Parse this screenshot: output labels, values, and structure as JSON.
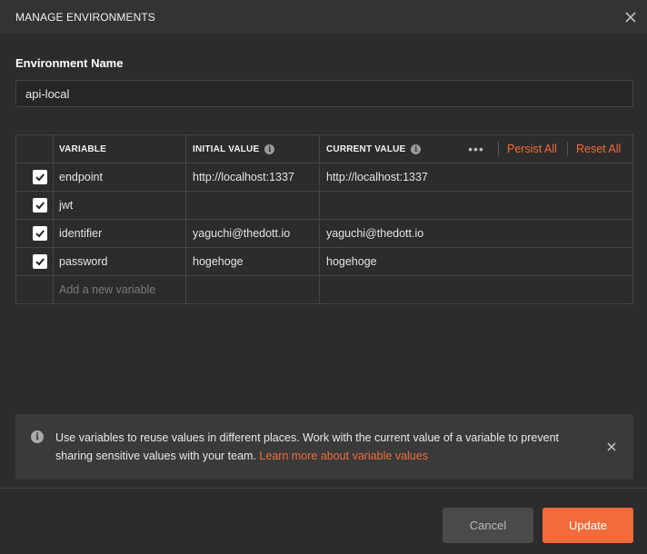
{
  "dialog": {
    "title": "MANAGE ENVIRONMENTS"
  },
  "environment": {
    "label": "Environment Name",
    "value": "api-local"
  },
  "table": {
    "headers": {
      "variable": "VARIABLE",
      "initial_value": "INITIAL VALUE",
      "current_value": "CURRENT VALUE"
    },
    "actions": {
      "more": "•••",
      "persist_all": "Persist All",
      "reset_all": "Reset All"
    },
    "rows": [
      {
        "checked": true,
        "variable": "endpoint",
        "initial": "http://localhost:1337",
        "current": "http://localhost:1337"
      },
      {
        "checked": true,
        "variable": "jwt",
        "initial": "",
        "current": ""
      },
      {
        "checked": true,
        "variable": "identifier",
        "initial": "yaguchi@thedott.io",
        "current": "yaguchi@thedott.io"
      },
      {
        "checked": true,
        "variable": "password",
        "initial": "hogehoge",
        "current": "hogehoge"
      }
    ],
    "new_variable_placeholder": "Add a new variable"
  },
  "banner": {
    "text": "Use variables to reuse values in different places. Work with the current value of a variable to prevent sharing sensitive values with your team.",
    "link": "Learn more about variable values"
  },
  "footer": {
    "cancel_label": "Cancel",
    "update_label": "Update"
  },
  "colors": {
    "accent": "#f26b3a",
    "background": "#2c2c2c",
    "titlebar": "#333333"
  },
  "icons": {
    "close": "close-icon",
    "info": "info-icon",
    "check": "checkmark-icon",
    "more": "more-horizontal-icon"
  }
}
